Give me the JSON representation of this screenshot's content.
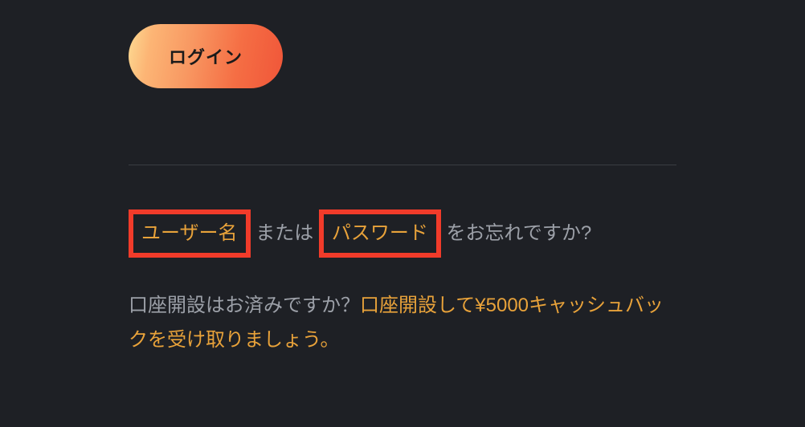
{
  "login": {
    "button_label": "ログイン"
  },
  "forgot": {
    "username_link": "ユーザー名",
    "separator": " または ",
    "password_link": "パスワード",
    "tail": " をお忘れですか?"
  },
  "signup": {
    "prompt_prefix": "口座開設はお済みですか？",
    "link_text": "口座開設して¥5000キャッシュバックを受け取りましょう。"
  }
}
